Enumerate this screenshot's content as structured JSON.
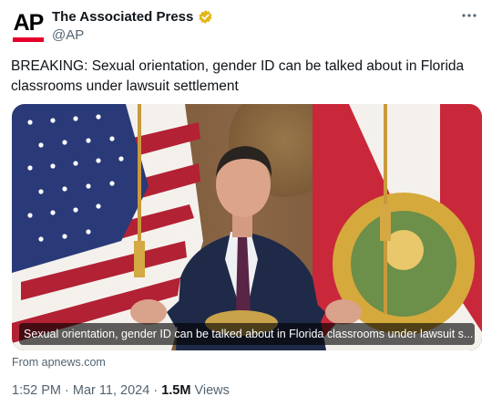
{
  "author": {
    "display_name": "The Associated Press",
    "handle": "@AP",
    "avatar_text": "AP",
    "verified_icon": "gold-verified-badge",
    "brand_red": "#e4002b",
    "verified_color": "#e2b719"
  },
  "tweet": {
    "text": "BREAKING: Sexual orientation, gender ID can be talked about in Florida classrooms under lawsuit settlement"
  },
  "media": {
    "caption": "Sexual orientation, gender ID can be talked about in Florida classrooms under lawsuit s..."
  },
  "link_source": "From apnews.com",
  "meta": {
    "time": "1:52 PM",
    "separator": "·",
    "date": "Mar 11, 2024",
    "views_count": "1.5M",
    "views_label": "Views"
  },
  "icons": {
    "more": "more-horizontal-icon"
  },
  "colors": {
    "text_primary": "#0f1419",
    "text_secondary": "#536471"
  }
}
